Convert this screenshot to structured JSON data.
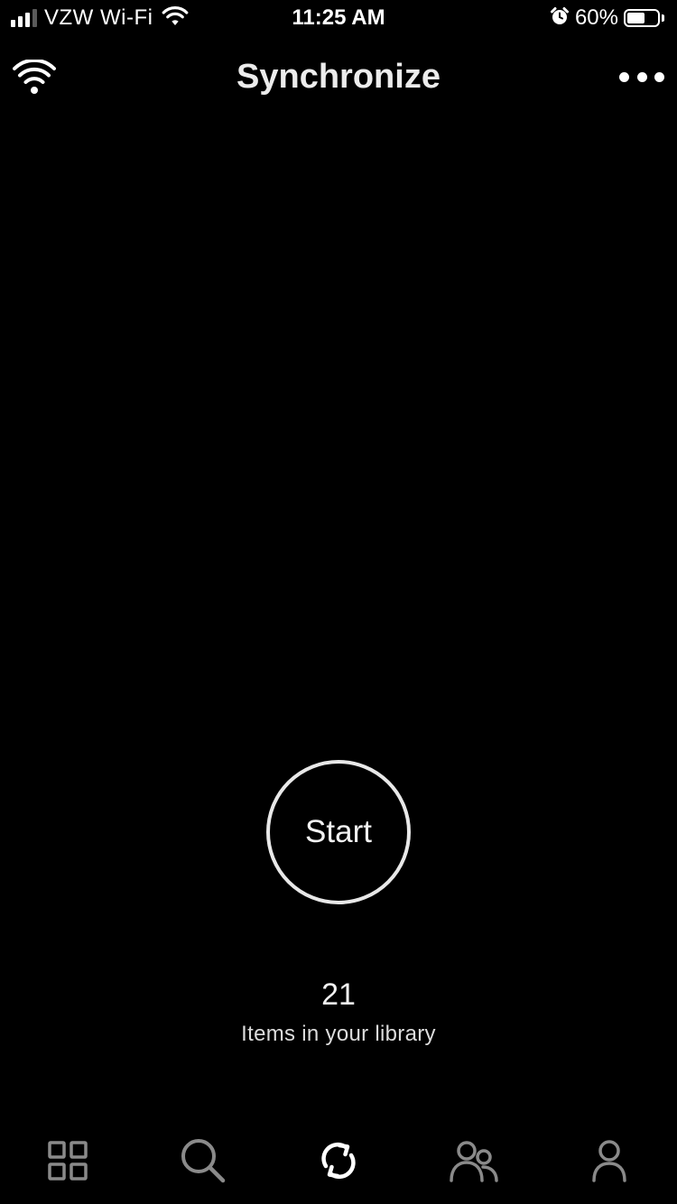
{
  "status_bar": {
    "carrier": "VZW Wi-Fi",
    "time": "11:25 AM",
    "battery_percent": "60%",
    "battery_level": 0.6,
    "signal_bars_active": 3,
    "signal_bars_total": 4,
    "icons": [
      "signal-icon",
      "wifi-icon",
      "alarm-icon",
      "battery-icon"
    ]
  },
  "nav": {
    "title": "Synchronize",
    "left_icon": "wifi-icon",
    "right_icon": "more-icon"
  },
  "sync": {
    "button_label": "Start",
    "item_count": "21",
    "item_caption": "Items in your library"
  },
  "tab_bar": {
    "active_index": 2,
    "active_color": "#ffffff",
    "inactive_color": "#8a8a8a",
    "tabs": [
      {
        "icon": "grid-icon"
      },
      {
        "icon": "search-icon"
      },
      {
        "icon": "sync-icon"
      },
      {
        "icon": "people-icon"
      },
      {
        "icon": "person-icon"
      }
    ]
  }
}
